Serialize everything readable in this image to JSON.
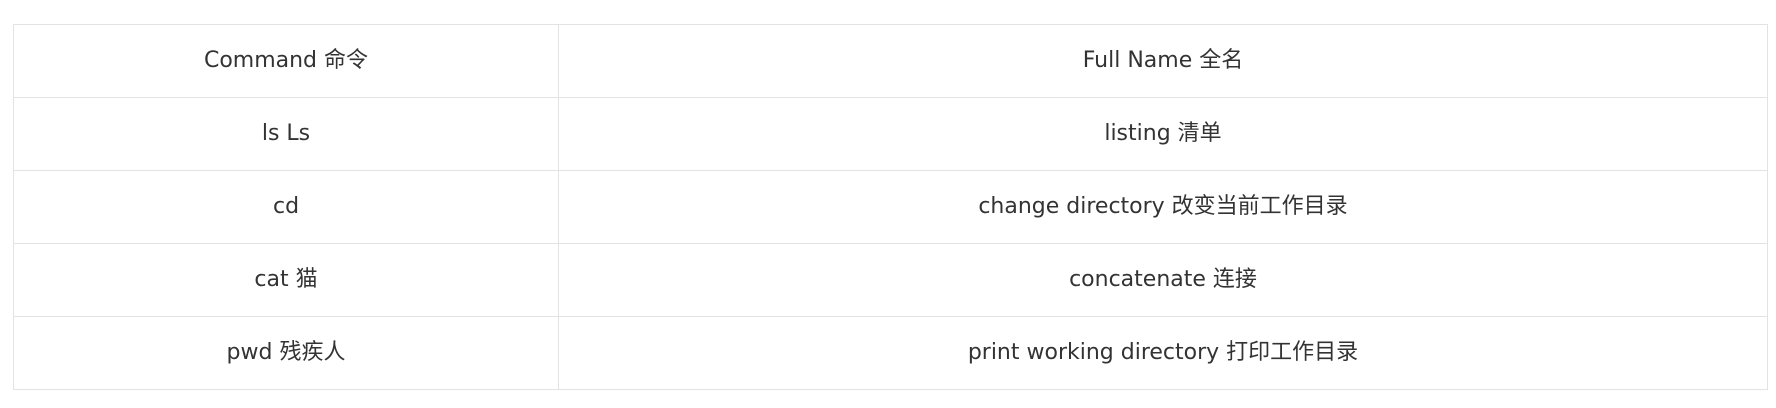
{
  "table": {
    "headers": [
      "Command 命令",
      "Full Name 全名"
    ],
    "rows": [
      [
        "ls Ls",
        "listing 清单"
      ],
      [
        "cd",
        "change directory 改变当前工作目录"
      ],
      [
        "cat 猫",
        "concatenate 连接"
      ],
      [
        "pwd 残疾人",
        "print working directory 打印工作目录"
      ]
    ]
  }
}
